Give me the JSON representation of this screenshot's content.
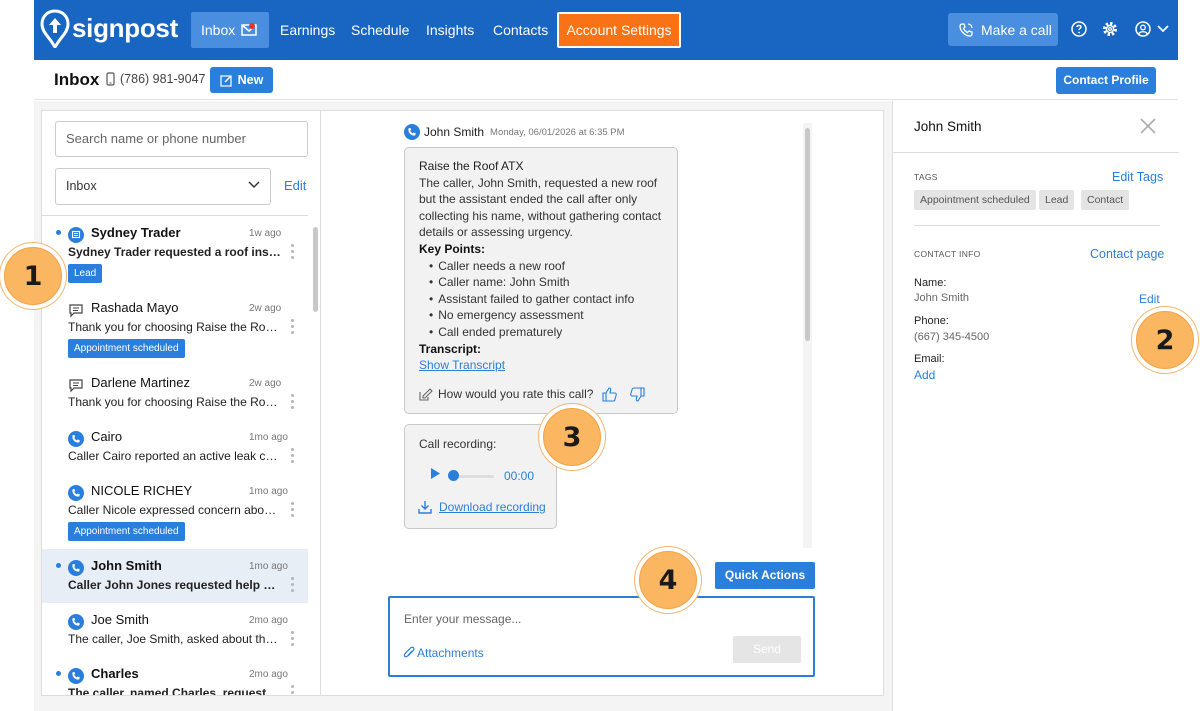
{
  "nav": {
    "brand": "signpost",
    "inbox": "Inbox",
    "earnings": "Earnings",
    "schedule": "Schedule",
    "insights": "Insights",
    "contacts": "Contacts",
    "account_settings": "Account Settings",
    "make_call": "Make a call"
  },
  "subheader": {
    "title": "Inbox",
    "phone": "(786) 981-9047",
    "new_label": "New",
    "contact_profile": "Contact Profile"
  },
  "sidebar": {
    "search_placeholder": "Search name or phone number",
    "filter_value": "Inbox",
    "edit_label": "Edit",
    "conversations": [
      {
        "name": "Sydney Trader",
        "time": "1w ago",
        "preview": "Sydney Trader requested a roof inspection",
        "badge": "Lead",
        "icon": "message-icon",
        "unread": true
      },
      {
        "name": "Rashada Mayo",
        "time": "2w ago",
        "preview": "Thank you for choosing Raise the Roof ATX",
        "badge": "Appointment scheduled",
        "icon": "chat-icon",
        "unread": false
      },
      {
        "name": "Darlene Martinez",
        "time": "2w ago",
        "preview": "Thank you for choosing Raise the Roof ATX",
        "badge": "",
        "icon": "chat-icon",
        "unread": false
      },
      {
        "name": "Cairo",
        "time": "1mo ago",
        "preview": "Caller Cairo reported an active leak causing",
        "badge": "",
        "icon": "phone-icon",
        "unread": false
      },
      {
        "name": "NICOLE RICHEY",
        "time": "1mo ago",
        "preview": "Caller Nicole expressed concern about her roof",
        "badge": "Appointment scheduled",
        "icon": "phone-icon",
        "unread": false
      },
      {
        "name": "John Smith",
        "time": "1mo ago",
        "preview": "Caller John Jones requested help with a roof",
        "badge": "",
        "icon": "phone-icon",
        "unread": true,
        "active": true
      },
      {
        "name": "Joe Smith",
        "time": "2mo ago",
        "preview": "The caller, Joe Smith, asked about the cost",
        "badge": "",
        "icon": "phone-icon",
        "unread": false
      },
      {
        "name": "Charles",
        "time": "2mo ago",
        "preview": "The caller, named Charles, requested the",
        "badge": "",
        "icon": "phone-icon",
        "unread": true
      }
    ]
  },
  "message": {
    "sender": "John Smith",
    "date": "Monday, 06/01/2026 at 6:35 PM",
    "summary_title": "Raise the Roof ATX",
    "summary_text": "The caller, John Smith, requested a new roof but the assistant ended the call after only collecting his name, without gathering contact details or assessing urgency.",
    "key_points_label": "Key Points:",
    "key_points": [
      "Caller needs a new roof",
      "Caller name: John Smith",
      "Assistant failed to gather contact info",
      "No emergency assessment",
      "Call ended prematurely"
    ],
    "transcript_label": "Transcript:",
    "show_transcript": "Show Transcript",
    "rate_prompt": "How would you rate this call?",
    "recording_label": "Call recording:",
    "recording_time": "00:00",
    "recording_progress": 0.0,
    "download_label": "Download recording"
  },
  "composer": {
    "quick_actions": "Quick Actions",
    "placeholder": "Enter your message...",
    "attachments": "Attachments",
    "send": "Send"
  },
  "contact_panel": {
    "name": "John Smith",
    "tags_label": "TAGS",
    "edit_tags": "Edit Tags",
    "tags": [
      "Appointment scheduled",
      "Lead",
      "Contact"
    ],
    "contact_info_label": "CONTACT INFO",
    "contact_page": "Contact page",
    "name_label": "Name:",
    "name_value": "John Smith",
    "edit_label": "Edit",
    "phone_label": "Phone:",
    "phone_value": "(667) 345-4500",
    "email_label": "Email:",
    "email_add": "Add"
  },
  "callouts": [
    "1",
    "2",
    "3",
    "4"
  ],
  "colors": {
    "brand_blue": "#1865c2",
    "accent_blue": "#2b7fdc",
    "account_orange": "#f97316",
    "callout_orange": "#fbb661"
  }
}
